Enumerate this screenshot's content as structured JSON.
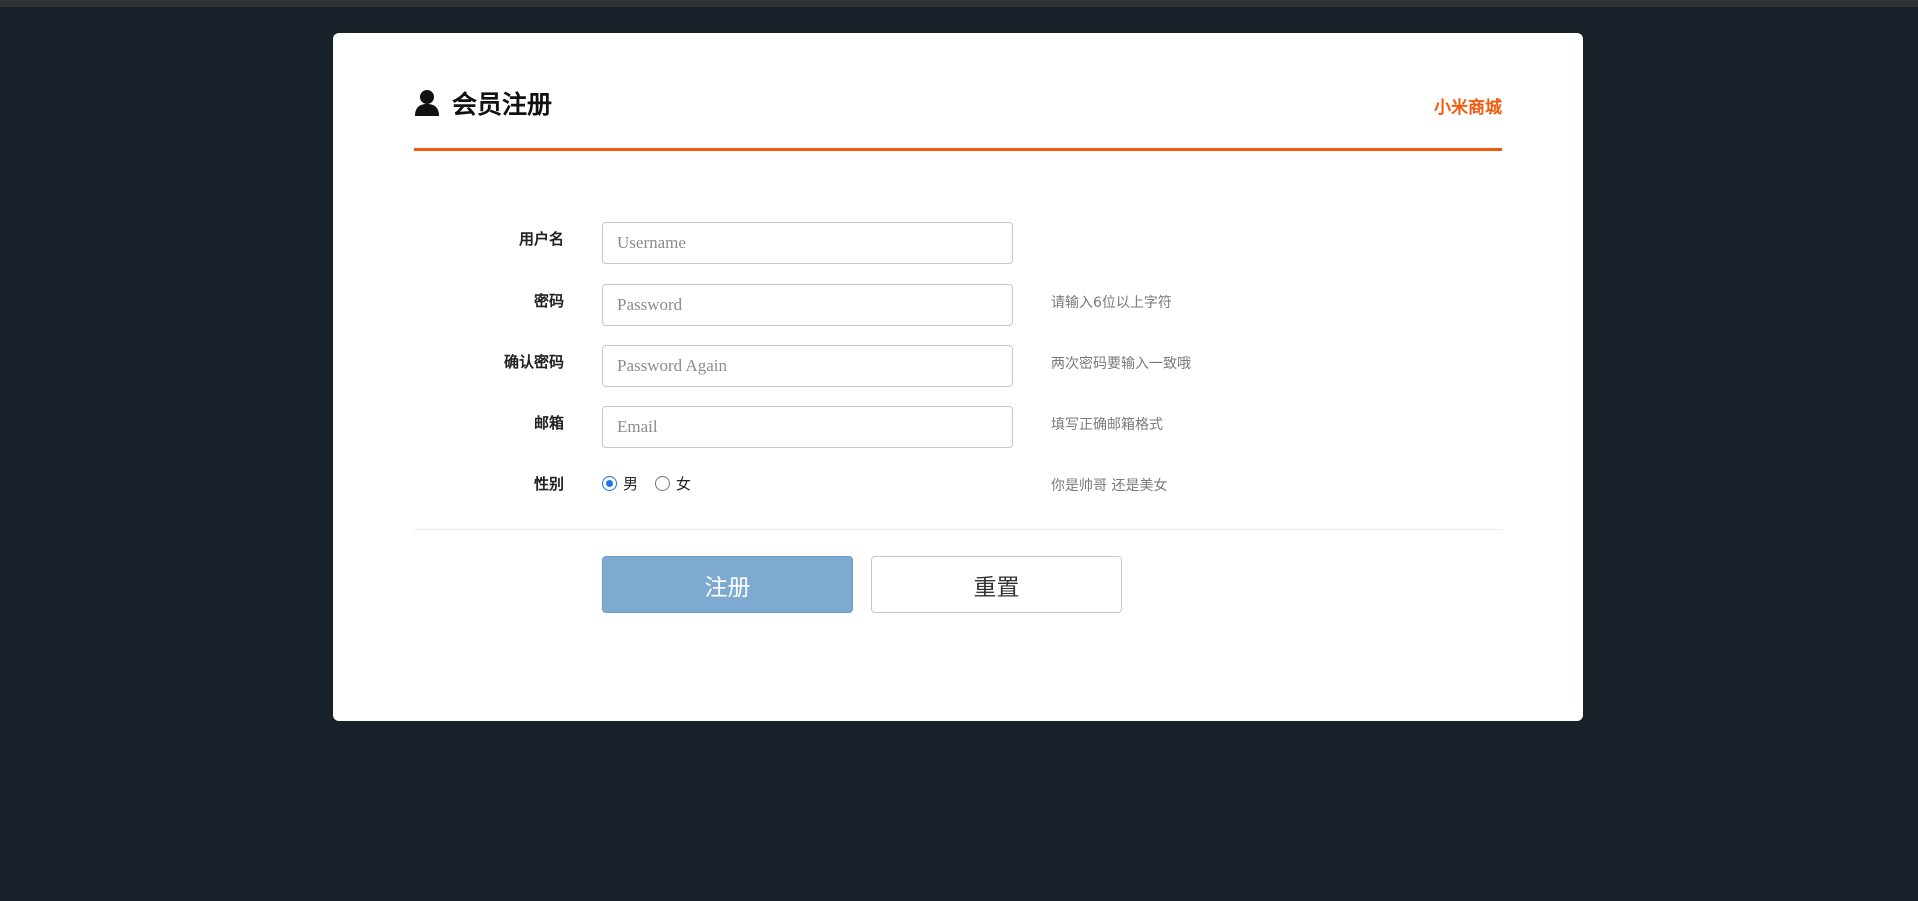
{
  "header": {
    "title": "会员注册",
    "brand_link": "小米商城"
  },
  "form": {
    "username": {
      "label": "用户名",
      "placeholder": "Username",
      "hint": ""
    },
    "password": {
      "label": "密码",
      "placeholder": "Password",
      "hint": "请输入6位以上字符"
    },
    "password_again": {
      "label": "确认密码",
      "placeholder": "Password Again",
      "hint": "两次密码要输入一致哦"
    },
    "email": {
      "label": "邮箱",
      "placeholder": "Email",
      "hint": "填写正确邮箱格式"
    },
    "gender": {
      "label": "性别",
      "options": [
        {
          "label": "男",
          "checked": true
        },
        {
          "label": "女",
          "checked": false
        }
      ],
      "hint": "你是帅哥 还是美女"
    }
  },
  "buttons": {
    "submit_label": "注册",
    "reset_label": "重置"
  },
  "colors": {
    "page_background": "#18212a",
    "accent": "#f25a0a",
    "submit_button": "#7ea9d1",
    "radio_selected": "#1a73e8"
  },
  "icons": {
    "header_icon": "user-icon"
  }
}
